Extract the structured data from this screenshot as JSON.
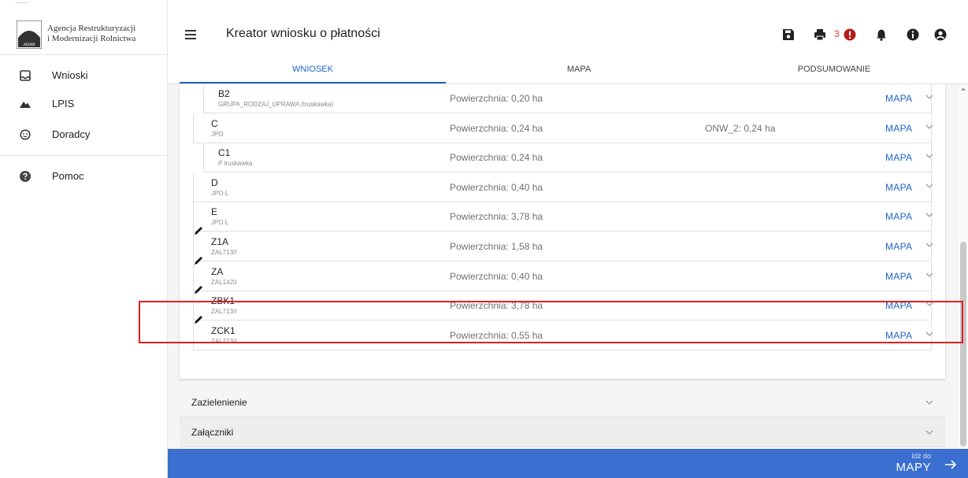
{
  "brand": {
    "line1": "Agencja Restrukturyzacji",
    "line2": "i Modernizacji Rolnictwa",
    "logo_text": "ARiMR"
  },
  "nav": [
    {
      "label": "Wnioski",
      "icon": "inbox-icon"
    },
    {
      "label": "LPIS",
      "icon": "mountains-icon"
    },
    {
      "label": "Doradcy",
      "icon": "smiley-icon"
    },
    {
      "label": "Pomoc",
      "icon": "help-icon"
    }
  ],
  "header": {
    "title": "Kreator wniosku o płatności",
    "error_count": "3"
  },
  "tabs": [
    {
      "label": "WNIOSEK",
      "active": true
    },
    {
      "label": "MAPA",
      "active": false
    },
    {
      "label": "PODSUMOWANIE",
      "active": false
    }
  ],
  "parcels": [
    {
      "id": "B2",
      "sub": "GRUPA_RODZAJ_UPRAWA (truskawka)",
      "area": "Powierzchnia: 0,20 ha",
      "onw": "",
      "map": "MAPA",
      "indent": true,
      "editable": false
    },
    {
      "id": "C",
      "sub": "JPO",
      "area": "Powierzchnia: 0,24 ha",
      "onw": "ONW_2: 0,24 ha",
      "map": "MAPA",
      "indent": false,
      "editable": false
    },
    {
      "id": "C1",
      "sub": "P truskawka",
      "area": "Powierzchnia: 0,24 ha",
      "onw": "",
      "map": "MAPA",
      "indent": true,
      "editable": false
    },
    {
      "id": "D",
      "sub": "JPO L",
      "area": "Powierzchnia: 0,40 ha",
      "onw": "",
      "map": "MAPA",
      "indent": false,
      "editable": false
    },
    {
      "id": "E",
      "sub": "JPO L",
      "area": "Powierzchnia: 3,78 ha",
      "onw": "",
      "map": "MAPA",
      "indent": false,
      "editable": false
    },
    {
      "id": "Z1A",
      "sub": "ZAL713/I",
      "area": "Powierzchnia: 1,58 ha",
      "onw": "",
      "map": "MAPA",
      "indent": false,
      "editable": true
    },
    {
      "id": "ZA",
      "sub": "ZAL1420",
      "area": "Powierzchnia: 0,40 ha",
      "onw": "",
      "map": "MAPA",
      "indent": false,
      "editable": true
    },
    {
      "id": "ZBK1",
      "sub": "ZAL713/I",
      "area": "Powierzchnia: 3,78 ha",
      "onw": "",
      "map": "MAPA",
      "indent": false,
      "editable": true
    },
    {
      "id": "ZCK1",
      "sub": "ZAL713/I",
      "area": "Powierzchnia: 0,55 ha",
      "onw": "",
      "map": "MAPA",
      "indent": false,
      "editable": true
    }
  ],
  "sections": [
    {
      "label": "Zazielenienie"
    },
    {
      "label": "Załączniki"
    }
  ],
  "footer": {
    "small": "Idź do",
    "big": "MAPY"
  },
  "colors": {
    "accent": "#1e63c8",
    "footer": "#3a6fcf",
    "error": "#e53935",
    "highlight": "#e02020"
  }
}
